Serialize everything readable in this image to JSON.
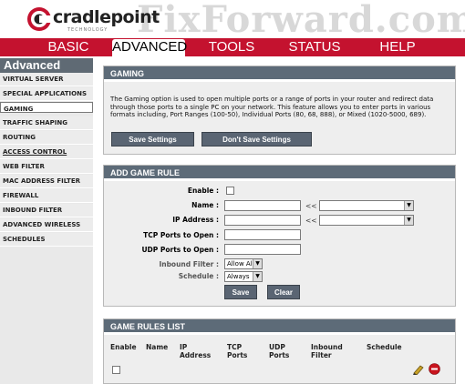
{
  "header": {
    "logo_text": "cradlepoint",
    "logo_sub": "TECHNOLOGY",
    "watermark": "FixForward.com"
  },
  "nav": {
    "tabs": [
      "BASIC",
      "ADVANCED",
      "TOOLS",
      "STATUS",
      "HELP"
    ],
    "active": "ADVANCED"
  },
  "sidebar": {
    "title": "Advanced",
    "items": [
      "VIRTUAL SERVER",
      "SPECIAL APPLICATIONS",
      "GAMING",
      "TRAFFIC SHAPING",
      "ROUTING",
      "ACCESS CONTROL",
      "WEB FILTER",
      "MAC ADDRESS FILTER",
      "FIREWALL",
      "INBOUND FILTER",
      "ADVANCED WIRELESS",
      "SCHEDULES"
    ]
  },
  "gaming": {
    "title": "GAMING",
    "description": "The Gaming option is used to open multiple ports or a range of ports in your router and redirect data through those ports to a single PC on your network. This feature allows you to enter ports in various formats including, Port Ranges (100-50), Individual Ports (80, 68, 888), or Mixed (1020-5000, 689).",
    "save_label": "Save Settings",
    "dont_save_label": "Don't Save Settings"
  },
  "add_rule": {
    "title": "ADD GAME RULE",
    "enable_label": "Enable :",
    "name_label": "Name :",
    "ip_label": "IP Address :",
    "tcp_label": "TCP Ports to Open :",
    "udp_label": "UDP Ports to Open :",
    "inbound_label": "Inbound Filter :",
    "schedule_label": "Schedule :",
    "arrows": "<<",
    "inbound_value": "Allow All",
    "schedule_value": "Always",
    "save_label": "Save",
    "clear_label": "Clear"
  },
  "rules_list": {
    "title": "GAME RULES LIST",
    "columns": [
      "Enable",
      "Name",
      "IP Address",
      "TCP Ports",
      "UDP Ports",
      "Inbound Filter",
      "Schedule"
    ]
  },
  "colors": {
    "nav": "#c4122f",
    "panel_header": "#5d6b78",
    "sidebar_title": "#5f6a74",
    "button": "#5a6573"
  }
}
